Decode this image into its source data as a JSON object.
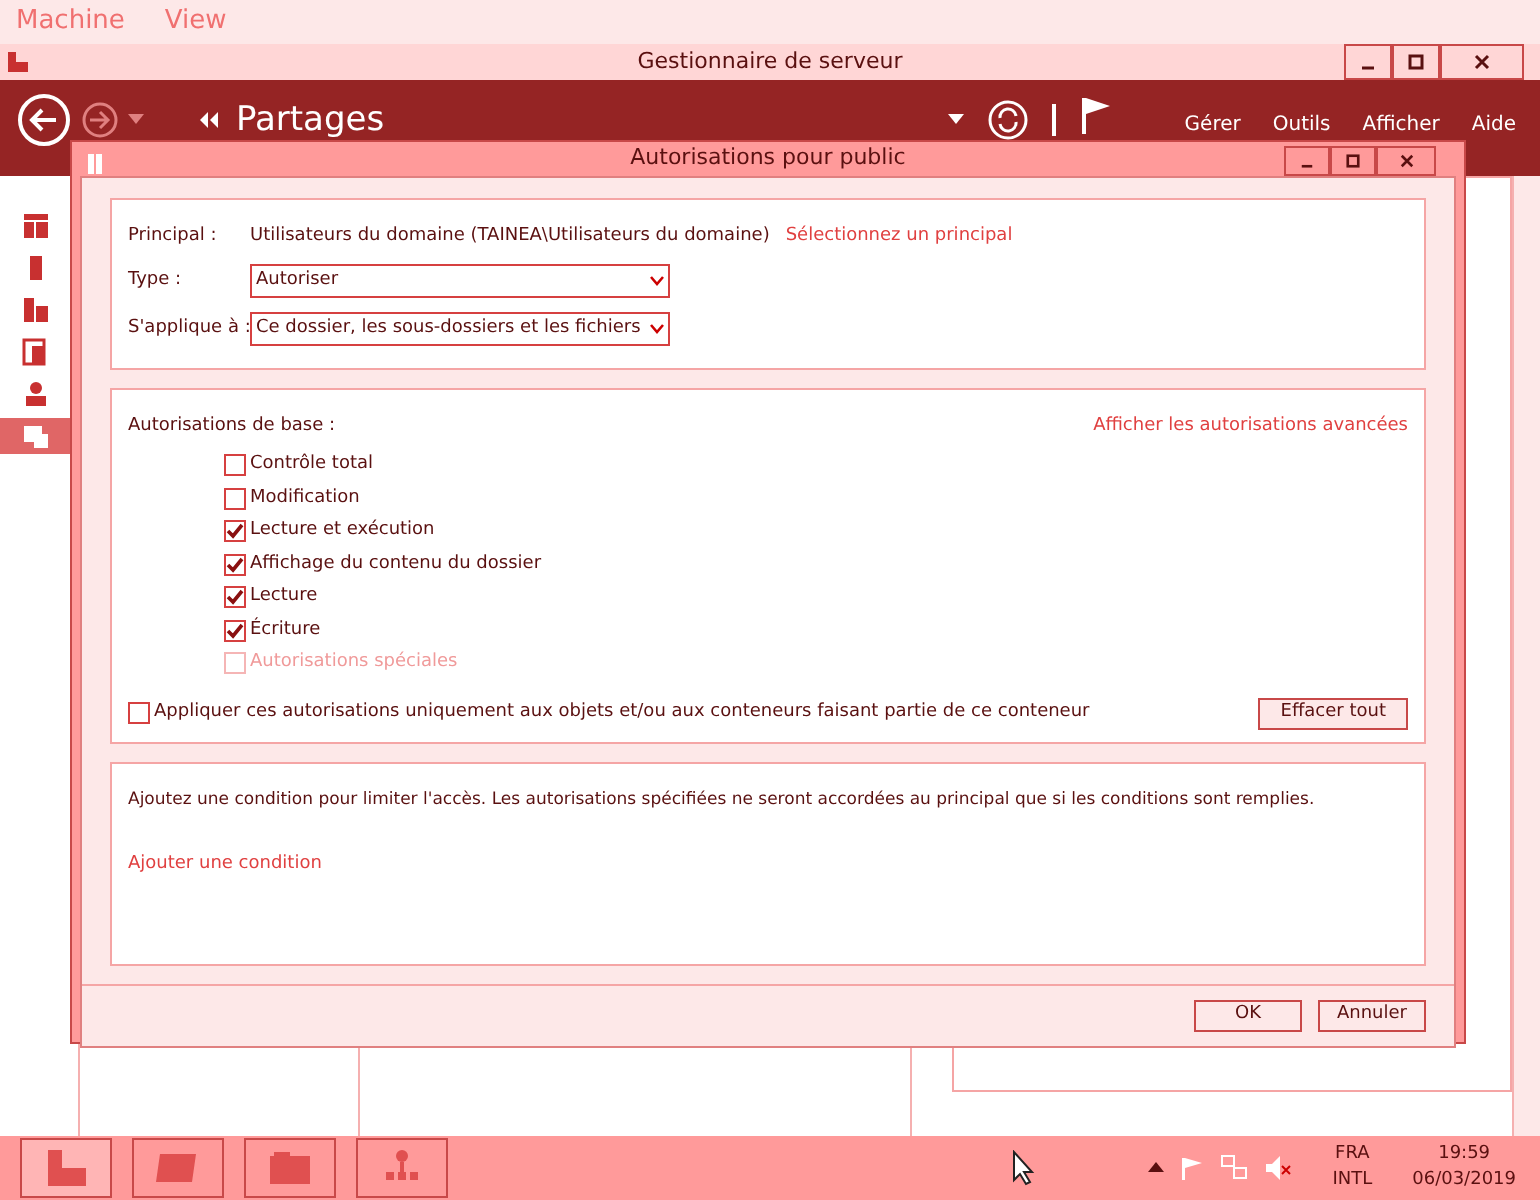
{
  "menu": [
    "Machine",
    "View"
  ],
  "window": {
    "title": "Gestionnaire de serveur"
  },
  "header": {
    "breadcrumb": "Partages",
    "menus": [
      "Gérer",
      "Outils",
      "Afficher",
      "Aide"
    ]
  },
  "sidebar": {
    "items": [
      {
        "selected": false
      },
      {
        "selected": false
      },
      {
        "selected": false
      },
      {
        "selected": false
      },
      {
        "selected": false
      },
      {
        "selected": true
      }
    ]
  },
  "dialog": {
    "title": "Autorisations pour public",
    "principal": {
      "label": "Principal :",
      "value": "Utilisateurs du domaine (TAINEA\\Utilisateurs du domaine)",
      "link": "Sélectionnez un principal"
    },
    "type": {
      "label": "Type :",
      "value": "Autoriser"
    },
    "applies_to": {
      "label": "S'applique à :",
      "value": "Ce dossier, les sous-dossiers et les fichiers"
    },
    "basic": {
      "label": "Autorisations de base :",
      "link": "Afficher les autorisations avancées",
      "items": [
        {
          "label": "Contrôle total",
          "checked": false,
          "disabled": false
        },
        {
          "label": "Modification",
          "checked": false,
          "disabled": false
        },
        {
          "label": "Lecture et exécution",
          "checked": true,
          "disabled": false
        },
        {
          "label": "Affichage du contenu du dossier",
          "checked": true,
          "disabled": false
        },
        {
          "label": "Lecture",
          "checked": true,
          "disabled": false
        },
        {
          "label": "Écriture",
          "checked": true,
          "disabled": false
        },
        {
          "label": "Autorisations spéciales",
          "checked": false,
          "disabled": true
        }
      ]
    },
    "apply_only": {
      "label": "Appliquer ces autorisations uniquement aux objets et/ou aux conteneurs faisant partie de ce conteneur",
      "checked": false
    },
    "clear_button": "Effacer tout",
    "condition": {
      "text": "Ajoutez une condition pour limiter l'accès. Les autorisations spécifiées ne seront accordées au principal que si les conditions sont remplies.",
      "link": "Ajouter une condition"
    },
    "buttons": [
      "OK",
      "Annuler"
    ]
  },
  "taskbar": {
    "apps": [
      {
        "selected": true
      },
      {
        "selected": false
      },
      {
        "selected": false
      },
      {
        "selected": false
      }
    ],
    "language": "FRA",
    "layout": "INTL",
    "time": "19:59",
    "date": "06/03/2019"
  }
}
